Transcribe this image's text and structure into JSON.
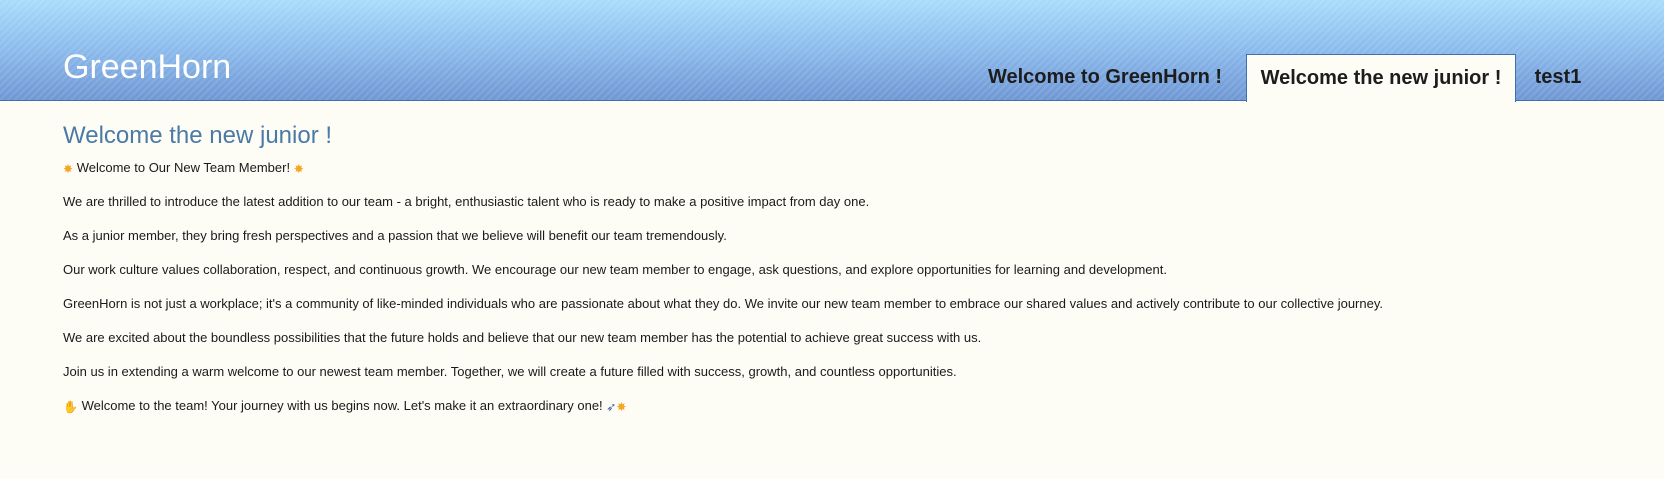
{
  "header": {
    "logo": "GreenHorn",
    "nav": {
      "tabs": [
        {
          "label": "Welcome to GreenHorn !",
          "active": false
        },
        {
          "label": "Welcome the new junior !",
          "active": true
        },
        {
          "label": "test1",
          "active": false
        }
      ]
    }
  },
  "main": {
    "title": "Welcome the new junior !",
    "intro": {
      "icon_before": "glowing-star-icon",
      "text": "Welcome to Our New Team Member!",
      "icon_after": "glowing-star-icon"
    },
    "paragraphs": [
      "We are thrilled to introduce the latest addition to our team - a bright, enthusiastic talent who is ready to make a positive impact from day one.",
      "As a junior member, they bring fresh perspectives and a passion that we believe will benefit our team tremendously.",
      "Our work culture values collaboration, respect, and continuous growth. We encourage our new team member to engage, ask questions, and explore opportunities for learning and development.",
      "GreenHorn is not just a workplace; it's a community of like-minded individuals who are passionate about what they do. We invite our new team member to embrace our shared values and actively contribute to our collective journey.",
      "We are excited about the boundless possibilities that the future holds and believe that our new team member has the potential to achieve great success with us.",
      "Join us in extending a warm welcome to our newest team member. Together, we will create a future filled with success, growth, and countless opportunities."
    ],
    "closing": {
      "icon_before": "clapping-hands-icon",
      "text": "Welcome to the team! Your journey with us begins now. Let's make it an extraordinary one!",
      "icons_after": [
        "rocket-icon",
        "glowing-star-icon"
      ]
    }
  },
  "colors": {
    "header_top": "#a9dcfb",
    "header_bottom": "#6f97d4",
    "header_border": "#3f6fb5",
    "page_background": "#fdfdf6",
    "title": "#4a7aa5",
    "body_text": "#1a1a1a"
  }
}
